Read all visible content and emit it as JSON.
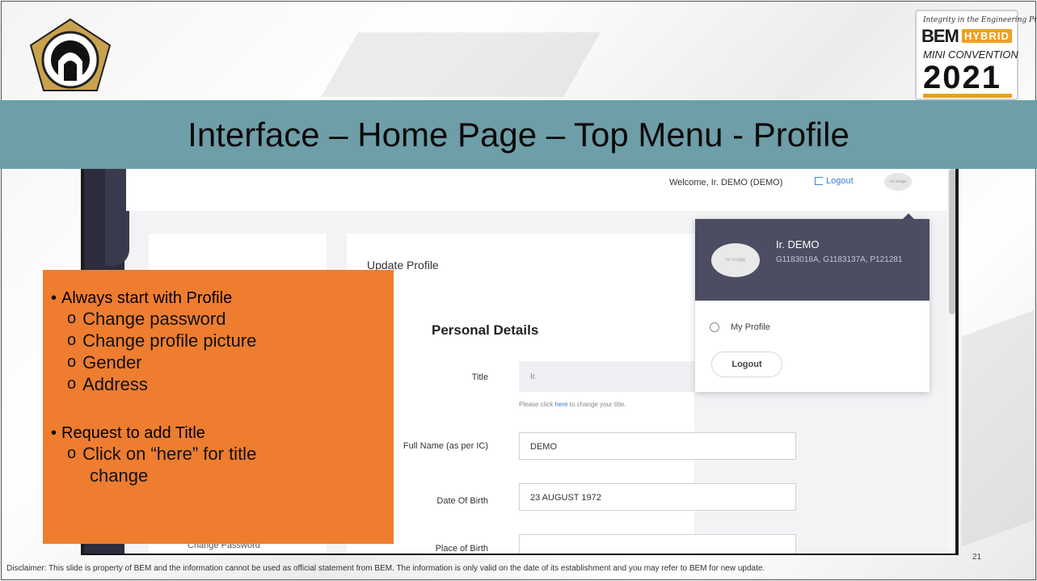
{
  "slide": {
    "title": "Interface – Home Page – Top Menu - Profile",
    "page_number": "21",
    "disclaimer": "Disclaimer: This slide is property of BEM and the information cannot be used as official statement from BEM. The information is only valid on the date of its establishment and you may refer to BEM for new update.",
    "colors": {
      "title_band": "#6e9ea8",
      "overlay": "#ee7d30",
      "menu_header": "#4c4c62",
      "link": "#3b7fd9"
    }
  },
  "logo_right": {
    "tagline": "Integrity in the Engineering Profession",
    "bem": "BEM",
    "hybrid": "HYBRID",
    "mini": "MINI CONVENTION",
    "year": "2021"
  },
  "app": {
    "topbar": {
      "welcome": "Welcome, Ir. DEMO (DEMO)",
      "logout": "Logout",
      "avatar_text": "no image"
    },
    "update_profile": "Update Profile",
    "personal_details": "Personal Details",
    "fields": {
      "title_label": "Title",
      "title_value": "Ir.",
      "hint_before": "Please click",
      "hint_link": "here",
      "hint_after": "to change your title.",
      "fullname_label": "Full Name (as per IC)",
      "fullname_value": "DEMO",
      "dob_label": "Date Of Birth",
      "dob_value": "23 AUGUST 1972",
      "pob_label": "Place of Birth"
    },
    "sidebar_item": "Change Password",
    "dropdown": {
      "avatar_text": "no image",
      "name": "Ir. DEMO",
      "ids": "G1183018A, G1183137A, P121281",
      "my_profile": "My Profile",
      "logout": "Logout"
    }
  },
  "overlay": {
    "bullet1": "Always start with Profile",
    "subs1": [
      "Change password",
      "Change profile picture",
      "Gender",
      "Address"
    ],
    "bullet2": "Request to add Title",
    "subs2": [
      "Click on “here” for title",
      "change"
    ]
  }
}
